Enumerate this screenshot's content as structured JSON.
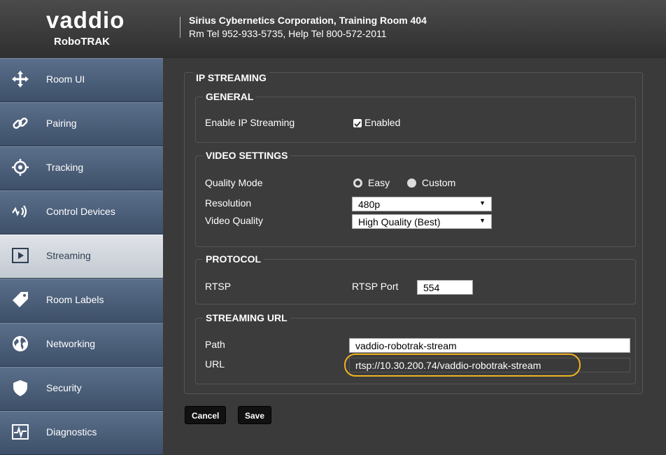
{
  "brand": {
    "logo_text": "vaddio",
    "product": "RoboTRAK"
  },
  "header": {
    "company": "Sirius Cybernetics Corporation, Training Room 404",
    "phones": "Rm Tel 952-933-5735, Help Tel 800-572-2011"
  },
  "sidebar": {
    "items": [
      {
        "label": "Room UI",
        "icon": "move-arrows-icon"
      },
      {
        "label": "Pairing",
        "icon": "link-icon"
      },
      {
        "label": "Tracking",
        "icon": "target-icon"
      },
      {
        "label": "Control Devices",
        "icon": "signal-waves-icon"
      },
      {
        "label": "Streaming",
        "icon": "play-icon",
        "active": true
      },
      {
        "label": "Room Labels",
        "icon": "tag-icon"
      },
      {
        "label": "Networking",
        "icon": "globe-icon"
      },
      {
        "label": "Security",
        "icon": "shield-icon"
      },
      {
        "label": "Diagnostics",
        "icon": "pulse-icon"
      }
    ]
  },
  "panel": {
    "title": "IP STREAMING",
    "general": {
      "title": "GENERAL",
      "enable_label": "Enable IP Streaming",
      "enabled_label": "Enabled",
      "enabled": true
    },
    "video": {
      "title": "VIDEO SETTINGS",
      "quality_mode_label": "Quality Mode",
      "easy_label": "Easy",
      "custom_label": "Custom",
      "quality_mode_selected": "Easy",
      "resolution_label": "Resolution",
      "resolution_value": "480p",
      "video_quality_label": "Video Quality",
      "video_quality_value": "High Quality (Best)"
    },
    "protocol": {
      "title": "PROTOCOL",
      "rtsp_label": "RTSP",
      "rtsp_port_label": "RTSP Port",
      "rtsp_port_value": "554"
    },
    "streaming_url": {
      "title": "STREAMING URL",
      "path_label": "Path",
      "path_value": "vaddio-robotrak-stream",
      "url_label": "URL",
      "url_value": "rtsp://10.30.200.74/vaddio-robotrak-stream"
    }
  },
  "buttons": {
    "cancel": "Cancel",
    "save": "Save"
  },
  "colors": {
    "highlight": "#f0b323",
    "sidebar_active": "#dfe3e8",
    "sidebar": "#4c5f7a"
  }
}
